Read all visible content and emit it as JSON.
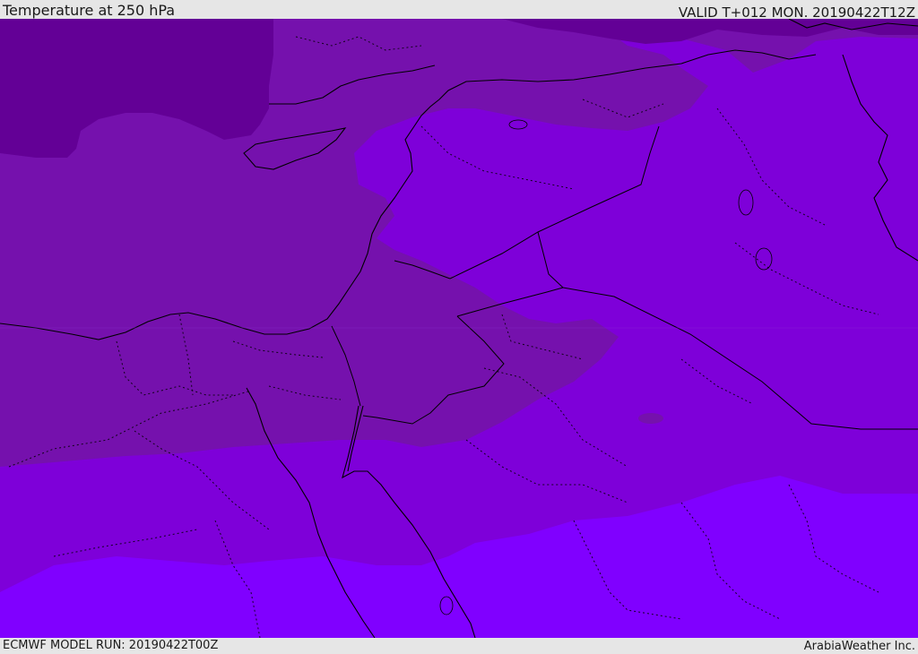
{
  "header": {
    "title": "Temperature at 250 hPa",
    "valid_time": "VALID T+012 MON. 20190422T12Z"
  },
  "footer": {
    "model_run": "ECMWF MODEL RUN: 20190422T00Z",
    "credit": "ArabiaWeather Inc."
  },
  "map": {
    "field": "temperature",
    "level": "250 hPa",
    "palette": {
      "coldest": "#630096",
      "cold": "#7511ad",
      "mid": "#7e00d9",
      "warm": "#8000ff"
    },
    "border_color": "#000000"
  }
}
